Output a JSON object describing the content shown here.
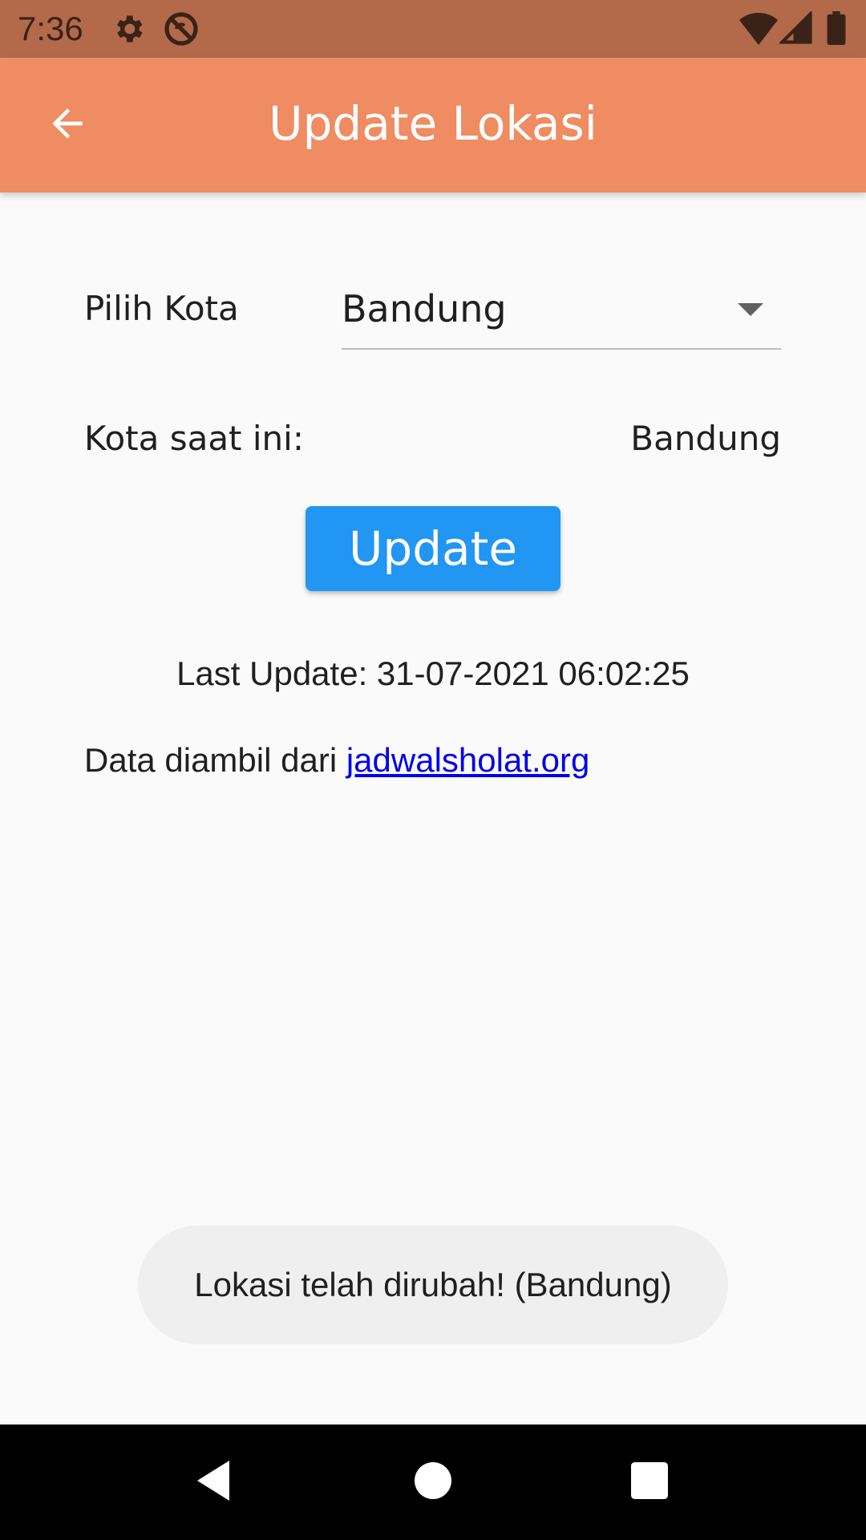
{
  "status_bar": {
    "time": "7:36",
    "icons": [
      "gear-icon",
      "no-sync-icon",
      "wifi-icon",
      "signal-icon",
      "battery-icon"
    ]
  },
  "app_bar": {
    "title": "Update Lokasi",
    "back_icon": "arrow-back-icon",
    "color": "#ef8c62"
  },
  "form": {
    "city_label": "Pilih Kota",
    "city_selected": "Bandung",
    "current_city_label": "Kota saat ini:",
    "current_city_value": "Bandung",
    "update_button_label": "Update",
    "update_button_color": "#2196f3",
    "last_update": "Last Update: 31-07-2021 06:02:25",
    "source_prefix": "Data diambil dari",
    "source_link": "jadwalsholat.org"
  },
  "toast": {
    "message": "Lokasi telah dirubah! (Bandung)"
  },
  "nav_bar": {
    "buttons": [
      "back-triangle-icon",
      "home-circle-icon",
      "recents-square-icon"
    ]
  }
}
